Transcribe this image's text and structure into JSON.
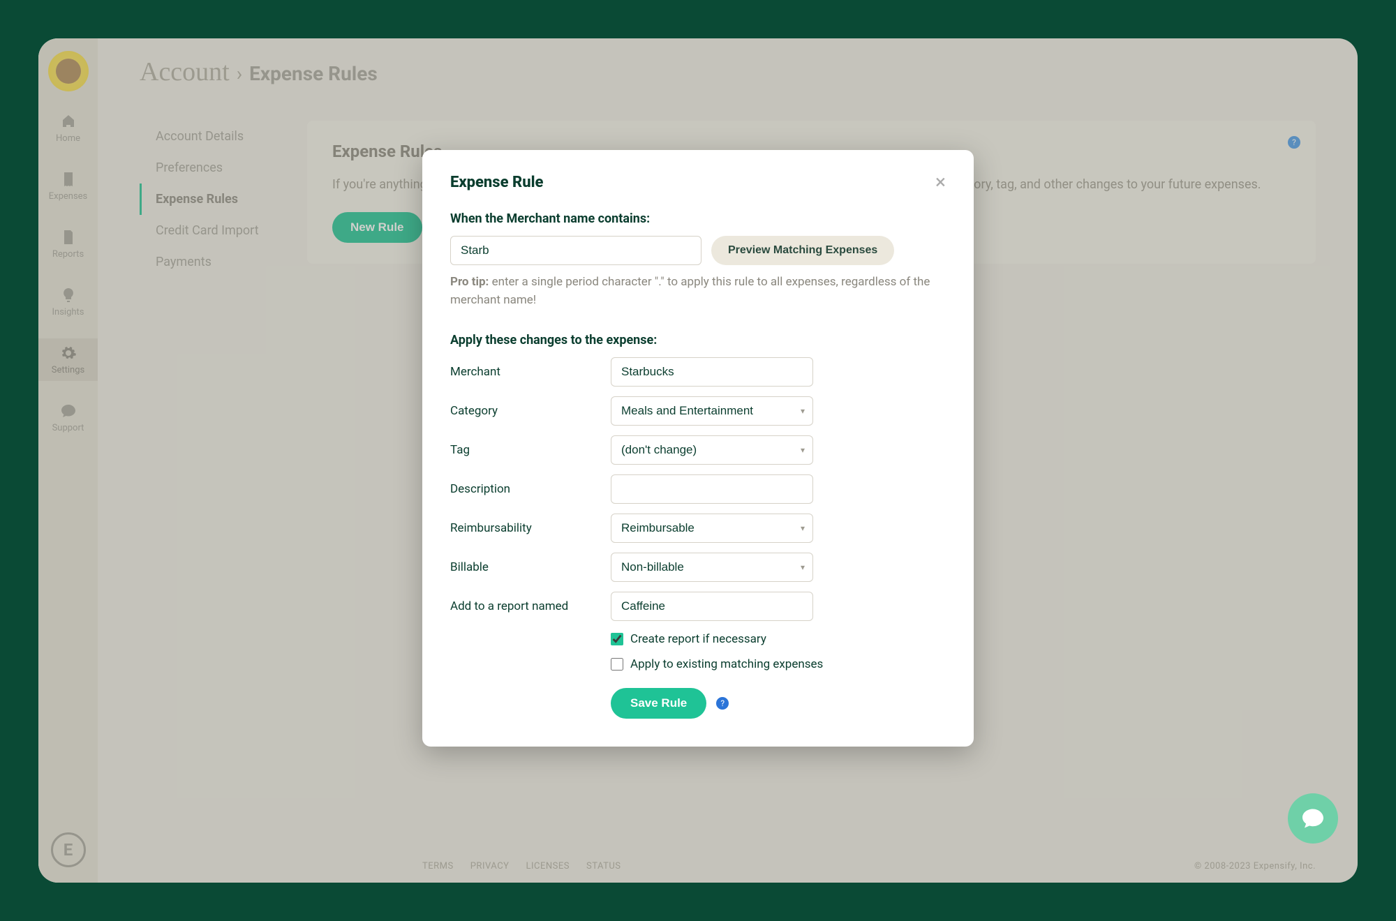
{
  "breadcrumb": {
    "root": "Account",
    "leaf": "Expense Rules"
  },
  "sidebar": {
    "items": [
      {
        "label": "Home"
      },
      {
        "label": "Expenses"
      },
      {
        "label": "Reports"
      },
      {
        "label": "Insights"
      },
      {
        "label": "Settings"
      },
      {
        "label": "Support"
      }
    ],
    "logo_letter": "E"
  },
  "subnav": {
    "items": [
      {
        "label": "Account Details"
      },
      {
        "label": "Preferences"
      },
      {
        "label": "Expense Rules",
        "active": true
      },
      {
        "label": "Credit Card Import"
      },
      {
        "label": "Payments"
      }
    ]
  },
  "card": {
    "title": "Expense Rules",
    "description": "If you're anything like us, you buy from the same merchants over and over. Enter rules below to auto complete category, tag, and other changes to your future expenses.",
    "new_rule_label": "New Rule"
  },
  "footer": {
    "links": [
      "TERMS",
      "PRIVACY",
      "LICENSES",
      "STATUS"
    ],
    "copyright": "© 2008-2023 Expensify, Inc."
  },
  "modal": {
    "title": "Expense Rule",
    "when_label": "When the Merchant name contains:",
    "merchant_match_value": "Starb",
    "preview_label": "Preview Matching Expenses",
    "protip_prefix": "Pro tip:",
    "protip_text": " enter a single period character \".\" to apply this rule to all expenses, regardless of the merchant name!",
    "apply_label": "Apply these changes to the expense:",
    "fields": {
      "merchant_label": "Merchant",
      "merchant_value": "Starbucks",
      "category_label": "Category",
      "category_value": "Meals and Entertainment",
      "tag_label": "Tag",
      "tag_value": "(don't change)",
      "description_label": "Description",
      "description_value": "",
      "reimbursability_label": "Reimbursability",
      "reimbursability_value": "Reimbursable",
      "billable_label": "Billable",
      "billable_value": "Non-billable",
      "report_label": "Add to a report named",
      "report_value": "Caffeine"
    },
    "create_report_label": "Create report if necessary",
    "create_report_checked": true,
    "apply_existing_label": "Apply to existing matching expenses",
    "apply_existing_checked": false,
    "save_label": "Save Rule"
  }
}
